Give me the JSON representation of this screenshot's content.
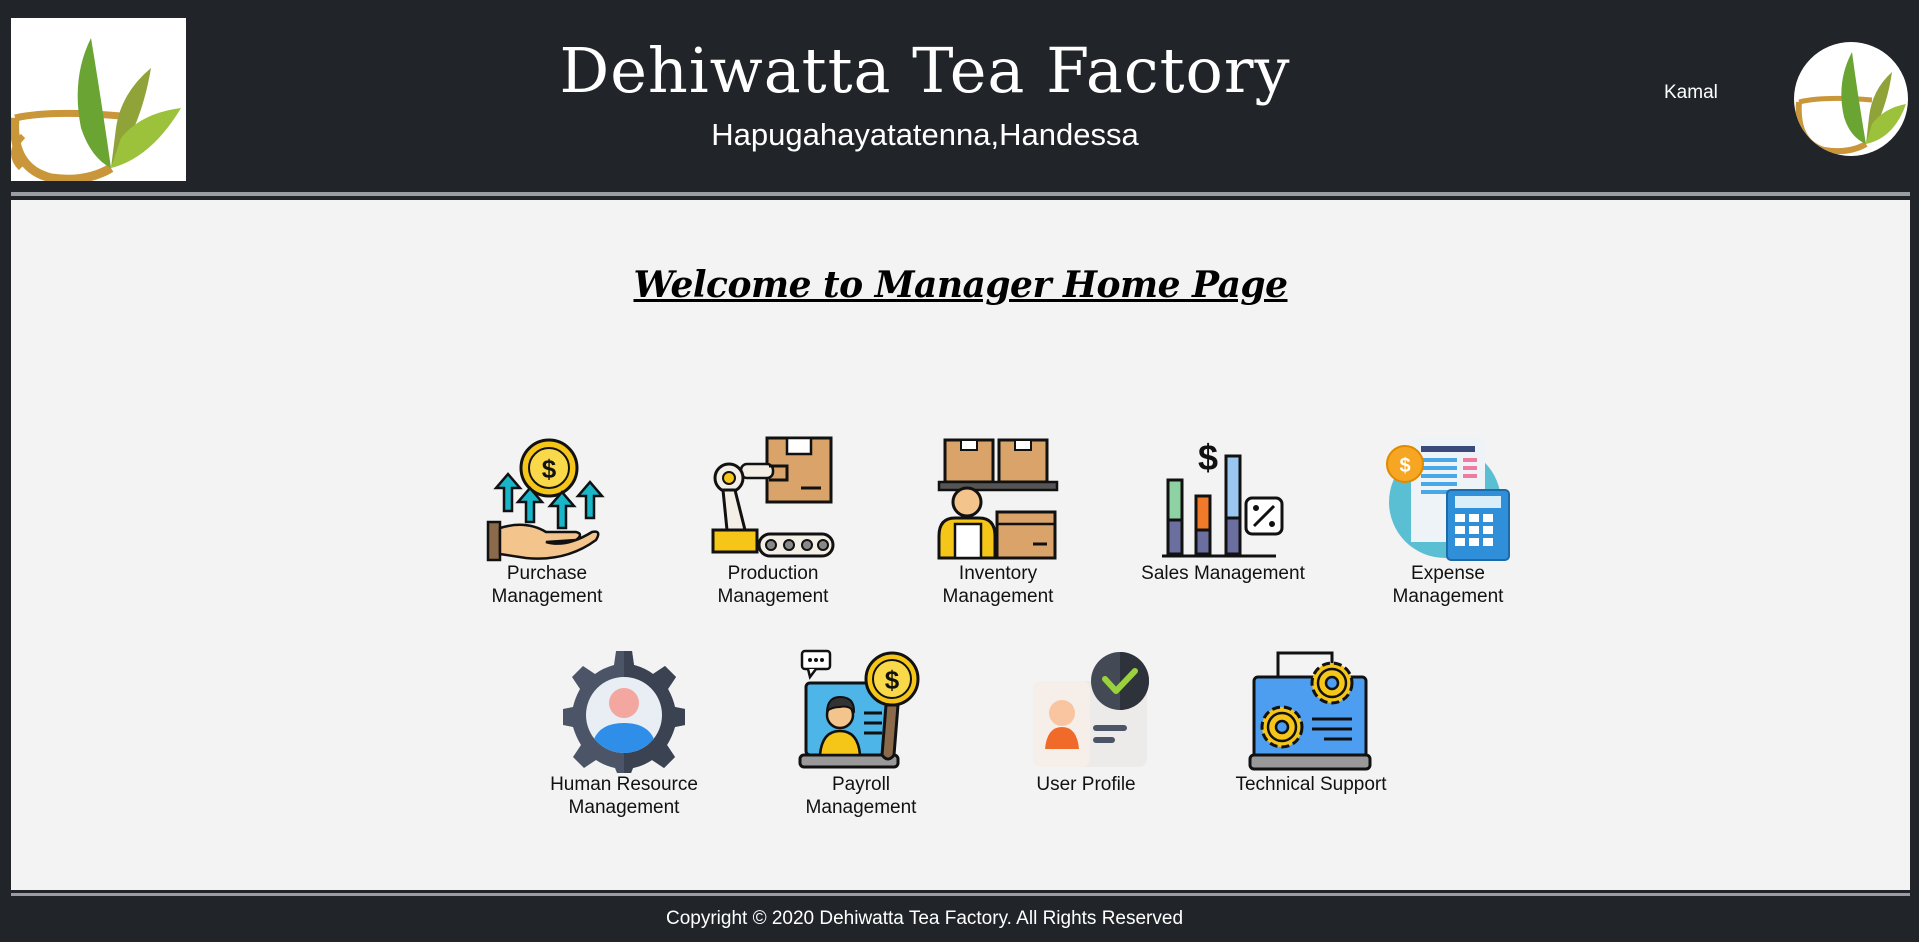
{
  "header": {
    "title": "Dehiwatta Tea Factory",
    "subtitle": "Hapugahayatatenna,Handessa",
    "user_name": "Kamal"
  },
  "main": {
    "welcome": "Welcome to Manager Home Page",
    "tiles_row1": [
      {
        "label": "Purchase Management",
        "icon": "purchase-icon"
      },
      {
        "label": "Production Management",
        "icon": "production-icon"
      },
      {
        "label": "Inventory Management",
        "icon": "inventory-icon"
      },
      {
        "label": "Sales Management",
        "icon": "sales-icon"
      },
      {
        "label": "Expense Management",
        "icon": "expense-icon"
      }
    ],
    "tiles_row2": [
      {
        "label": "Human Resource Management",
        "icon": "human-resource-icon"
      },
      {
        "label": "Payroll Management",
        "icon": "payroll-icon"
      },
      {
        "label": "User Profile",
        "icon": "user-profile-icon"
      },
      {
        "label": "Technical Support",
        "icon": "technical-support-icon"
      }
    ]
  },
  "footer": {
    "copyright": "Copyright © 2020 Dehiwatta Tea Factory. All Rights Reserved"
  },
  "colors": {
    "header_bg": "#212529",
    "main_bg": "#f4f3f3",
    "divider": "#9a9ea2"
  }
}
